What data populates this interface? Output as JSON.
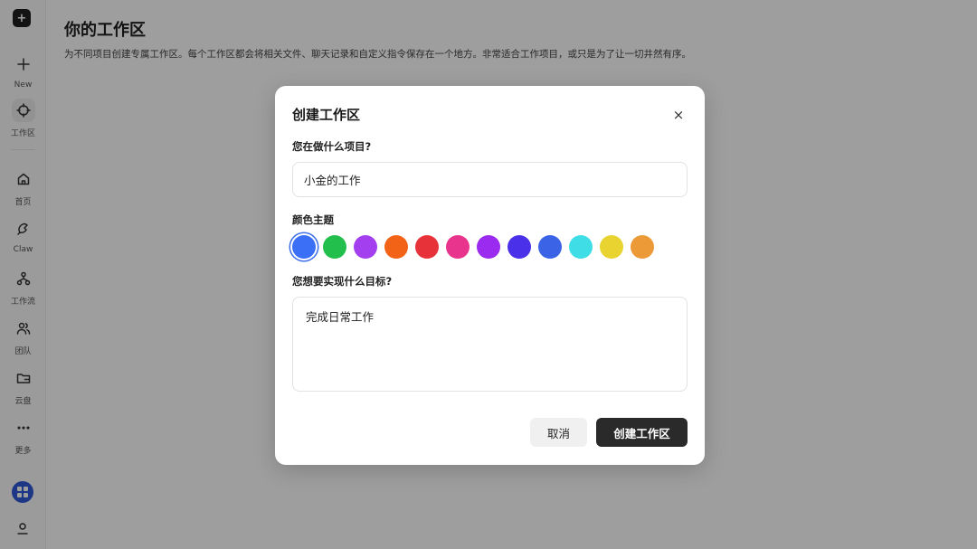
{
  "sidebar": {
    "logo_glyph": "+",
    "items": [
      {
        "label": "New",
        "icon": "plus-icon"
      },
      {
        "label": "工作区",
        "icon": "workspace-crosshair-icon"
      },
      {
        "label": "首页",
        "icon": "home-icon"
      },
      {
        "label": "Claw",
        "icon": "claw-icon"
      },
      {
        "label": "工作流",
        "icon": "workflow-icon"
      },
      {
        "label": "团队",
        "icon": "team-icon"
      },
      {
        "label": "云盘",
        "icon": "cloud-drive-icon"
      },
      {
        "label": "更多",
        "icon": "more-dots-icon"
      }
    ]
  },
  "page": {
    "title": "你的工作区",
    "description": "为不同项目创建专属工作区。每个工作区都会将相关文件、聊天记录和自定义指令保存在一个地方。非常适合工作项目，或只是为了让一切井然有序。"
  },
  "modal": {
    "title": "创建工作区",
    "close_glyph": "×",
    "project_label": "您在做什么项目?",
    "project_value": "小金的工作",
    "color_label": "颜色主题",
    "colors": [
      "#3b6ff5",
      "#22bf4d",
      "#a43ff0",
      "#f26318",
      "#e8323a",
      "#e8348c",
      "#9b2bee",
      "#4a30e8",
      "#3a63e6",
      "#3fdde6",
      "#e8d331",
      "#ec9a38"
    ],
    "selected_color_index": 0,
    "goal_label": "您想要实现什么目标?",
    "goal_value": "完成日常工作",
    "cancel_label": "取消",
    "create_label": "创建工作区"
  }
}
